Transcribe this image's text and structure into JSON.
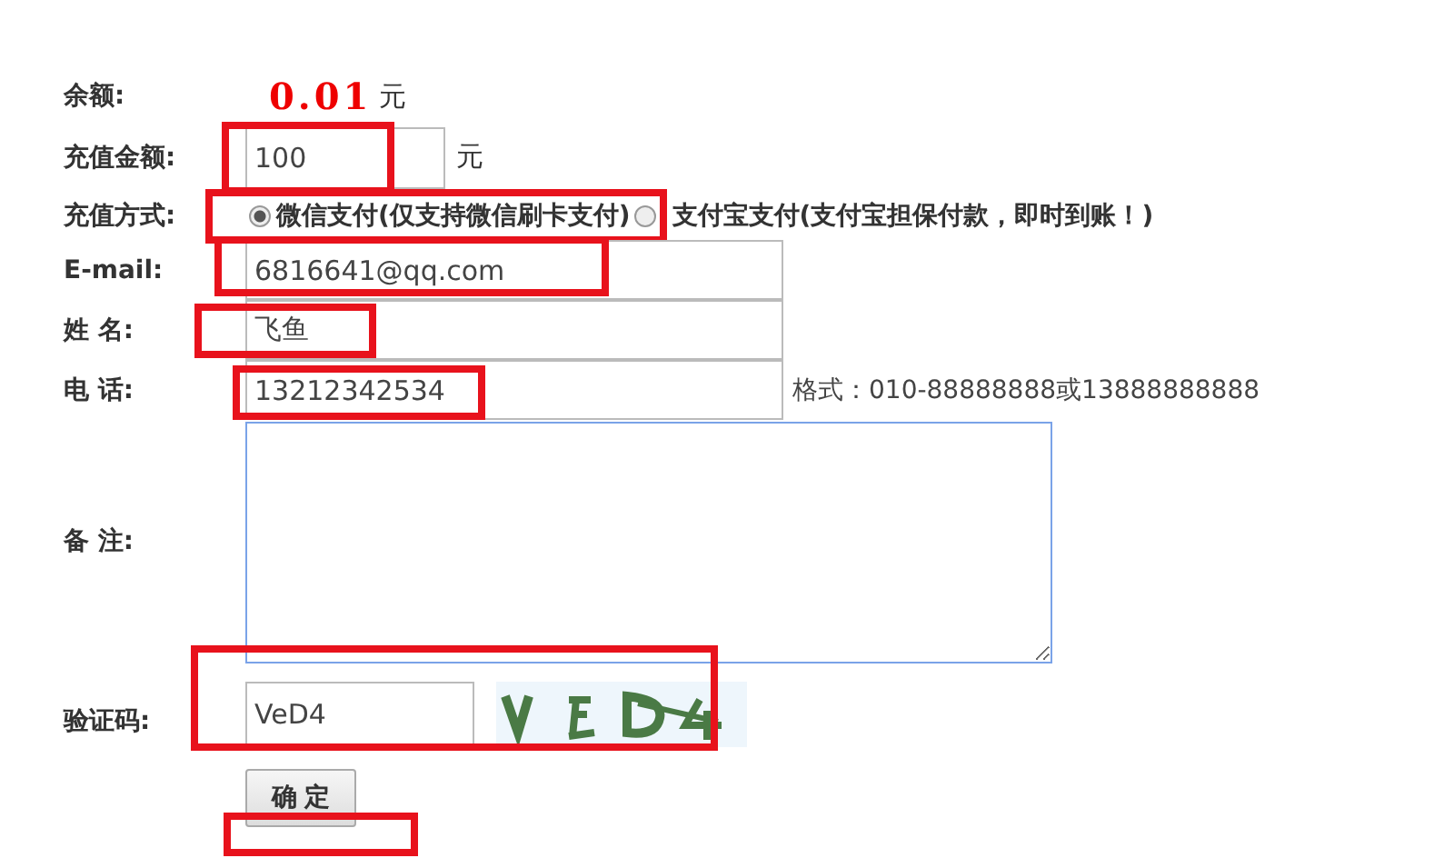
{
  "balance": {
    "label": "余额:",
    "amount": "0.01",
    "unit": "元"
  },
  "amount": {
    "label": "充值金额:",
    "value": "100",
    "unit": "元"
  },
  "payment": {
    "label": "充值方式:",
    "options": [
      {
        "label": "微信支付(仅支持微信刷卡支付)",
        "selected": true
      },
      {
        "label": "支付宝支付(支付宝担保付款，即时到账！)",
        "selected": false
      }
    ]
  },
  "email": {
    "label": "E-mail:",
    "value": "6816641@qq.com"
  },
  "name": {
    "label": "姓 名:",
    "value": "飞鱼"
  },
  "phone": {
    "label": "电 话:",
    "value": "13212342534",
    "hint": "格式：010-88888888或13888888888"
  },
  "note": {
    "label": "备 注:"
  },
  "captcha": {
    "label": "验证码:",
    "value": "VeD4"
  },
  "submit": "确 定"
}
